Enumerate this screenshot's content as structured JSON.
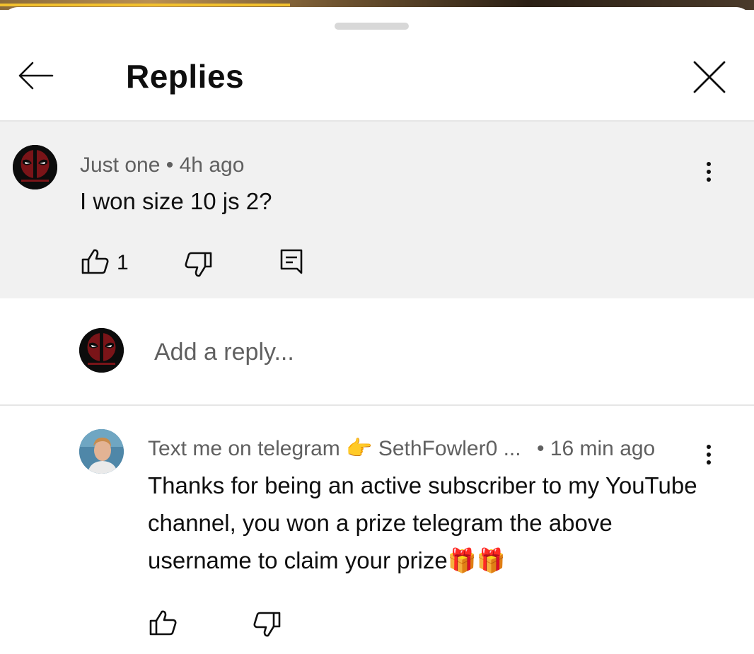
{
  "header": {
    "title": "Replies"
  },
  "parent_comment": {
    "author": "Just one",
    "separator": "•",
    "time": "4h ago",
    "text": "I won size 10 js 2?",
    "like_count": "1"
  },
  "reply_box": {
    "placeholder": "Add a reply..."
  },
  "reply": {
    "author": "Text me on telegram",
    "author_emoji": "👉",
    "author_handle": "SethFowler0 ...",
    "separator": "•",
    "time": "16 min ago",
    "text": "Thanks for being an active subscriber to my YouTube channel, you won a prize telegram the above username to claim your prize",
    "text_emoji": "🎁🎁"
  },
  "colors": {
    "highlight_bg": "#f1f1f1",
    "meta_text": "#606060",
    "progress": "#f2c12e"
  },
  "icons": [
    "arrow-left-icon",
    "close-icon",
    "more-vert-icon",
    "thumb-up-icon",
    "thumb-down-icon",
    "reply-comment-icon"
  ]
}
